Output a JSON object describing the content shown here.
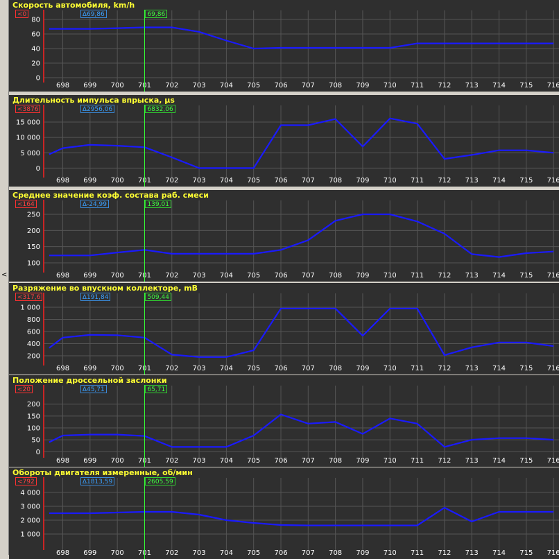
{
  "chart_data": [
    {
      "type": "line",
      "title": "Скорость автомобиля, km/h",
      "badges": {
        "left": "0",
        "delta": "Δ69,86",
        "cursor": "69,86"
      },
      "yticks": [
        0,
        20,
        40,
        60,
        80
      ],
      "ytick_labels": [
        "0",
        "20",
        "40",
        "60",
        "80"
      ],
      "ylim": [
        0,
        80
      ],
      "x": [
        697.5,
        698,
        699,
        700,
        701,
        702,
        703,
        704,
        705,
        706,
        707,
        708,
        709,
        710,
        711,
        712,
        713,
        714,
        715,
        716
      ],
      "values": [
        67,
        67,
        67,
        68,
        69,
        69,
        63,
        51,
        40,
        41,
        41,
        41,
        41,
        41,
        47,
        47,
        47,
        47,
        47,
        47
      ]
    },
    {
      "type": "line",
      "title": "Длительность импульса впрыска, µs",
      "badges": {
        "left": "3876",
        "delta": "Δ2956,06",
        "cursor": "6832,06"
      },
      "yticks": [
        0,
        5000,
        10000,
        15000
      ],
      "ytick_labels": [
        "0",
        "5 000",
        "10 000",
        "15 000"
      ],
      "ylim": [
        -1500,
        17500
      ],
      "x": [
        697.5,
        698,
        699,
        700,
        701,
        702,
        703,
        704,
        705,
        706,
        707,
        708,
        709,
        710,
        711,
        712,
        713,
        714,
        715,
        716
      ],
      "values": [
        4500,
        6500,
        7600,
        7300,
        6800,
        3500,
        0,
        0,
        0,
        14000,
        14000,
        16000,
        7000,
        16200,
        14500,
        3000,
        4300,
        5800,
        5800,
        5000
      ]
    },
    {
      "type": "line",
      "title": "Среднее значение коэф. состава раб. смеси",
      "badges": {
        "left": "164",
        "delta": "Δ-24,99",
        "cursor": "139,01"
      },
      "yticks": [
        100,
        150,
        200,
        250
      ],
      "ytick_labels": [
        "100",
        "150",
        "200",
        "250"
      ],
      "ylim": [
        85,
        265
      ],
      "x": [
        697.5,
        698,
        699,
        700,
        701,
        702,
        703,
        704,
        705,
        706,
        707,
        708,
        709,
        710,
        711,
        712,
        713,
        714,
        715,
        716
      ],
      "values": [
        123,
        123,
        123,
        132,
        140,
        128,
        128,
        128,
        128,
        140,
        170,
        230,
        250,
        250,
        228,
        190,
        127,
        118,
        130,
        135
      ]
    },
    {
      "type": "line",
      "title": "Разряжение во впускном коллекторе, mB",
      "badges": {
        "left": "317,6",
        "delta": "Δ191,84",
        "cursor": "509,44"
      },
      "yticks": [
        200,
        400,
        600,
        800,
        1000
      ],
      "ytick_labels": [
        "200",
        "400",
        "600",
        "800",
        "1 000"
      ],
      "ylim": [
        120,
        1080
      ],
      "x": [
        697.5,
        698,
        699,
        700,
        701,
        702,
        703,
        704,
        705,
        706,
        707,
        708,
        709,
        710,
        711,
        712,
        713,
        714,
        715,
        716
      ],
      "values": [
        330,
        500,
        545,
        540,
        500,
        220,
        180,
        180,
        290,
        980,
        980,
        980,
        530,
        980,
        980,
        210,
        340,
        420,
        420,
        360
      ]
    },
    {
      "type": "line",
      "title": "Положение дроссельной заслонки",
      "badges": {
        "left": "20",
        "delta": "Δ45,71",
        "cursor": "65,71"
      },
      "yticks": [
        0,
        50,
        100,
        150,
        200
      ],
      "ytick_labels": [
        "0",
        "50",
        "100",
        "150",
        "200"
      ],
      "ylim": [
        -5,
        240
      ],
      "x": [
        697.5,
        698,
        699,
        700,
        701,
        702,
        703,
        704,
        705,
        706,
        707,
        708,
        709,
        710,
        711,
        712,
        713,
        714,
        715,
        716
      ],
      "values": [
        40,
        68,
        72,
        72,
        66,
        20,
        20,
        20,
        68,
        157,
        118,
        125,
        75,
        140,
        118,
        20,
        50,
        57,
        57,
        50
      ]
    },
    {
      "type": "line",
      "title": "Обороты двигателя измеренные, об/мин",
      "badges": {
        "left": "792",
        "delta": "Δ1813,59",
        "cursor": "2605,59"
      },
      "yticks": [
        1000,
        2000,
        3000,
        4000
      ],
      "ytick_labels": [
        "1 000",
        "2 000",
        "3 000",
        "4 000"
      ],
      "ylim": [
        200,
        4400
      ],
      "x": [
        697.5,
        698,
        699,
        700,
        701,
        702,
        703,
        704,
        705,
        706,
        707,
        708,
        709,
        710,
        711,
        712,
        713,
        714,
        715,
        716
      ],
      "values": [
        2500,
        2500,
        2500,
        2550,
        2600,
        2600,
        2400,
        2000,
        1800,
        1650,
        1620,
        1620,
        1620,
        1620,
        1620,
        2900,
        1900,
        2600,
        2600,
        2600
      ]
    }
  ],
  "x_axis": {
    "tick_values": [
      698,
      699,
      700,
      701,
      702,
      703,
      704,
      705,
      706,
      707,
      708,
      709,
      710,
      711,
      712,
      713,
      714,
      715,
      716
    ],
    "tick_labels": [
      "698",
      "699",
      "700",
      "701",
      "702",
      "703",
      "704",
      "705",
      "706",
      "707",
      "708",
      "709",
      "710",
      "711",
      "712",
      "713",
      "714",
      "715",
      "716"
    ],
    "xlim": [
      697.3,
      716.2
    ],
    "cursor_x": 701
  },
  "colors": {
    "background": "#2f2f2f",
    "grid": "#555555",
    "line": "#1a1aff",
    "cursor": "#33ff33",
    "title": "#ffff33",
    "left_axis": "#ff2020"
  },
  "ui": {
    "left_arrow": "<"
  }
}
